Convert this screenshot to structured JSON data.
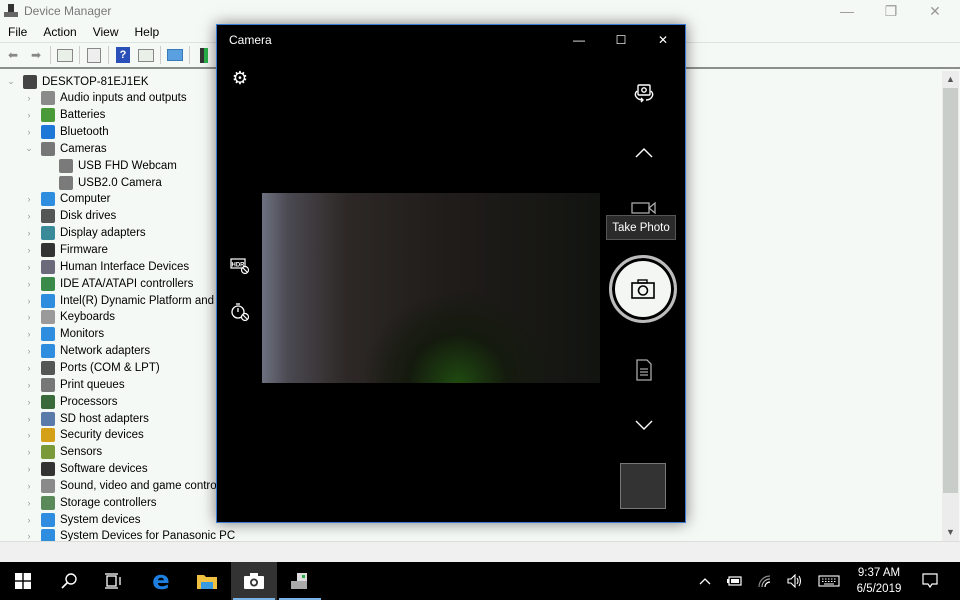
{
  "device_manager": {
    "title": "Device Manager",
    "window_controls": {
      "minimize": "—",
      "restore": "❐",
      "close": "✕"
    },
    "menu": [
      "File",
      "Action",
      "View",
      "Help"
    ],
    "toolbar": [
      "back-icon",
      "forward-icon",
      "show-hide-console-tree-icon",
      "properties-icon",
      "help-icon",
      "action-pane-icon",
      "scan-hardware-icon",
      "update-driver-icon"
    ],
    "tree": {
      "root": "DESKTOP-81EJ1EK",
      "items": [
        {
          "label": "Audio inputs and outputs",
          "icon": "speaker-icon",
          "color": "#8a8a8a",
          "expanded": false
        },
        {
          "label": "Batteries",
          "icon": "battery-icon",
          "color": "#4a9a3a",
          "expanded": false
        },
        {
          "label": "Bluetooth",
          "icon": "bluetooth-icon",
          "color": "#1e78d7",
          "expanded": false
        },
        {
          "label": "Cameras",
          "icon": "webcam-icon",
          "color": "#777777",
          "expanded": true,
          "children": [
            {
              "label": "USB FHD Webcam",
              "icon": "webcam-icon"
            },
            {
              "label": "USB2.0 Camera",
              "icon": "webcam-icon"
            }
          ]
        },
        {
          "label": "Computer",
          "icon": "computer-icon",
          "color": "#2f8de0",
          "expanded": false
        },
        {
          "label": "Disk drives",
          "icon": "disk-drive-icon",
          "color": "#555555",
          "expanded": false
        },
        {
          "label": "Display adapters",
          "icon": "display-adapter-icon",
          "color": "#3a8a9a",
          "expanded": false
        },
        {
          "label": "Firmware",
          "icon": "firmware-icon",
          "color": "#333333",
          "expanded": false
        },
        {
          "label": "Human Interface Devices",
          "icon": "hid-icon",
          "color": "#6a6a7a",
          "expanded": false
        },
        {
          "label": "IDE ATA/ATAPI controllers",
          "icon": "ide-controller-icon",
          "color": "#3a8a4a",
          "expanded": false
        },
        {
          "label": "Intel(R) Dynamic Platform and Thermal Framework",
          "icon": "system-device-icon",
          "color": "#2f8de0",
          "expanded": false
        },
        {
          "label": "Keyboards",
          "icon": "keyboard-icon",
          "color": "#9a9a9a",
          "expanded": false
        },
        {
          "label": "Monitors",
          "icon": "monitor-icon",
          "color": "#2f8de0",
          "expanded": false
        },
        {
          "label": "Network adapters",
          "icon": "network-adapter-icon",
          "color": "#2f8de0",
          "expanded": false
        },
        {
          "label": "Ports (COM & LPT)",
          "icon": "port-icon",
          "color": "#555555",
          "expanded": false
        },
        {
          "label": "Print queues",
          "icon": "printer-icon",
          "color": "#777777",
          "expanded": false
        },
        {
          "label": "Processors",
          "icon": "processor-icon",
          "color": "#3a6a3a",
          "expanded": false
        },
        {
          "label": "SD host adapters",
          "icon": "sd-card-icon",
          "color": "#5a7aaa",
          "expanded": false
        },
        {
          "label": "Security devices",
          "icon": "security-device-icon",
          "color": "#d4a017",
          "expanded": false
        },
        {
          "label": "Sensors",
          "icon": "sensor-icon",
          "color": "#7a9a3a",
          "expanded": false
        },
        {
          "label": "Software devices",
          "icon": "software-device-icon",
          "color": "#333333",
          "expanded": false
        },
        {
          "label": "Sound, video and game controllers",
          "icon": "speaker-icon",
          "color": "#8a8a8a",
          "expanded": false
        },
        {
          "label": "Storage controllers",
          "icon": "storage-controller-icon",
          "color": "#5a8a5a",
          "expanded": false
        },
        {
          "label": "System devices",
          "icon": "system-device-icon",
          "color": "#2f8de0",
          "expanded": false
        },
        {
          "label": "System Devices for Panasonic PC",
          "icon": "system-device-icon",
          "color": "#2f8de0",
          "expanded": false
        }
      ]
    }
  },
  "camera": {
    "title": "Camera",
    "window_controls": {
      "minimize": "—",
      "maximize": "☐",
      "close": "✕"
    },
    "tooltip": "Take Photo",
    "left_controls": [
      "settings-icon",
      "hdr-off-icon",
      "timer-off-icon"
    ],
    "right_controls": [
      "switch-camera-icon",
      "mode-up-icon",
      "video-mode-icon",
      "take-photo-icon",
      "document-mode-icon",
      "mode-down-icon"
    ]
  },
  "taskbar": {
    "apps": [
      "start-icon",
      "search-icon",
      "task-view-icon",
      "edge-icon",
      "file-explorer-icon",
      "camera-app-icon",
      "device-manager-app-icon"
    ],
    "active_app": "camera-app-icon",
    "tray": [
      "show-hidden-icons",
      "battery-icon",
      "wifi-icon",
      "volume-icon",
      "touch-keyboard-icon"
    ],
    "time": "9:37 AM",
    "date": "6/5/2019"
  }
}
